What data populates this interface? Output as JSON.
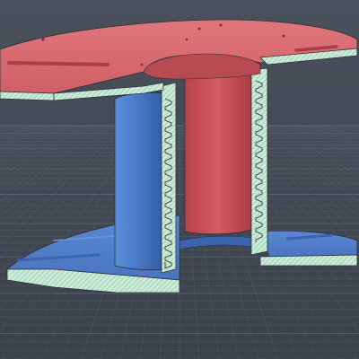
{
  "viewport": {
    "background_top": "#4b515c",
    "background_bottom": "#3c424c",
    "grid_color": "#6a7281",
    "grid_major_color": "#7b8493"
  },
  "model": {
    "outer_color": "#d9636a",
    "outer_dark": "#b84a52",
    "inner_color": "#4f7fcf",
    "inner_dark": "#3a64ad",
    "section_fill": "#cdebd9",
    "section_hatch": "#7fbf9a",
    "edge_color": "#2d2f36"
  }
}
